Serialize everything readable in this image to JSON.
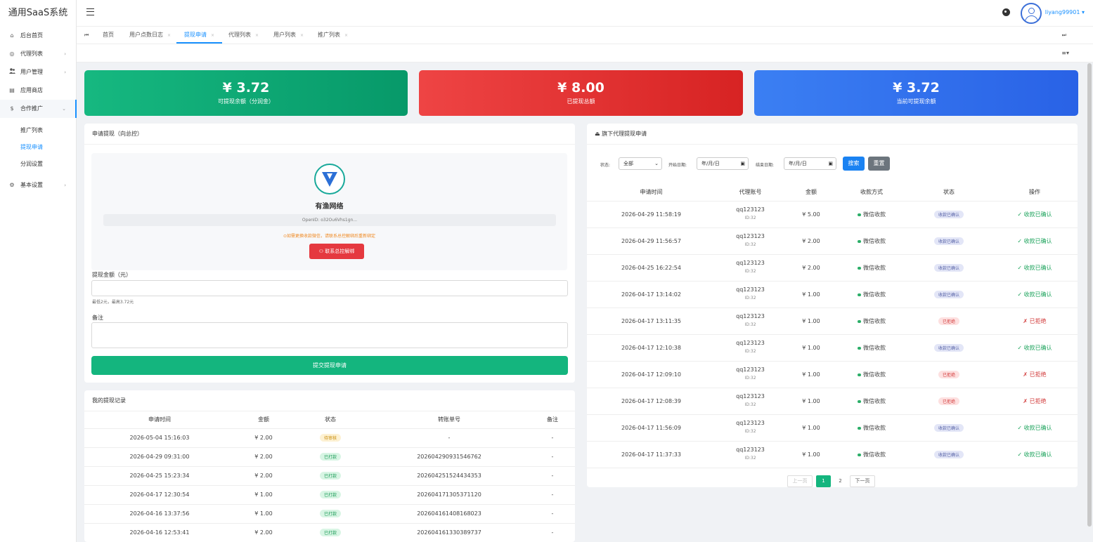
{
  "app": {
    "title": "通用SaaS系统"
  },
  "sidebar": {
    "items": [
      {
        "label": "后台首页",
        "icon": "home-icon",
        "glyph": "⌂",
        "arrow": ""
      },
      {
        "label": "代理列表",
        "icon": "globe-icon",
        "glyph": "◎",
        "arrow": "›"
      },
      {
        "label": "用户管理",
        "icon": "users-icon",
        "glyph": "👥",
        "arrow": "›"
      },
      {
        "label": "应用商店",
        "icon": "store-icon",
        "glyph": "▤",
        "arrow": ""
      },
      {
        "label": "合作推广",
        "icon": "dollar-icon",
        "glyph": "$",
        "arrow": "⌄"
      },
      {
        "label": "基本设置",
        "icon": "gear-icon",
        "glyph": "⚙",
        "arrow": "›"
      }
    ],
    "subitems": [
      {
        "label": "推广列表"
      },
      {
        "label": "提现申请"
      },
      {
        "label": "分润设置"
      }
    ]
  },
  "header": {
    "username": "liyang99901",
    "user_caret": "▾",
    "menu_caret": "≡▾"
  },
  "tabs": [
    {
      "label": "首页",
      "close": ""
    },
    {
      "label": "用户点数日志",
      "close": "×"
    },
    {
      "label": "提现申请",
      "close": "×"
    },
    {
      "label": "代理列表",
      "close": "×"
    },
    {
      "label": "用户列表",
      "close": "×"
    },
    {
      "label": "推广列表",
      "close": "×"
    }
  ],
  "stats": [
    {
      "value": "¥ 3.72",
      "label": "可提现余额（分润金）",
      "color": "#10ab73"
    },
    {
      "value": "¥ 8.00",
      "label": "已提现总额",
      "color": "#e33232"
    },
    {
      "value": "¥ 3.72",
      "label": "当前可提现余额",
      "color": "#3270ec"
    }
  ],
  "apply": {
    "title": "申请提现（向总控）",
    "user_name": "有渔网络",
    "openid": "OpenID: o32Ou6Vhs1gn...",
    "warning": "⊙如需更换收款微信，请联系总控解绑后重新绑定",
    "unbind_button": "联系总控解绑",
    "amount_label": "提现金额（元）",
    "amount_value": "",
    "amount_help": "最低2元，最高3.72元",
    "remark_label": "备注",
    "remark_value": "",
    "submit_button": "提交提现申请"
  },
  "records": {
    "title": "我的提现记录",
    "columns": [
      "申请时间",
      "金额",
      "状态",
      "转账单号",
      "备注"
    ],
    "rows": [
      {
        "time": "2026-05-04 15:16:03",
        "amount": "¥ 2.00",
        "status": "待审核",
        "status_type": "pending",
        "order": "-",
        "remark": "-"
      },
      {
        "time": "2026-04-29 09:31:00",
        "amount": "¥ 2.00",
        "status": "已打款",
        "status_type": "paid",
        "order": "202604290931546762",
        "remark": "-"
      },
      {
        "time": "2026-04-25 15:23:34",
        "amount": "¥ 2.00",
        "status": "已打款",
        "status_type": "paid",
        "order": "202604251524434353",
        "remark": "-"
      },
      {
        "time": "2026-04-17 12:30:54",
        "amount": "¥ 1.00",
        "status": "已打款",
        "status_type": "paid",
        "order": "202604171305371120",
        "remark": "-"
      },
      {
        "time": "2026-04-16 13:37:56",
        "amount": "¥ 1.00",
        "status": "已打款",
        "status_type": "paid",
        "order": "202604161408168023",
        "remark": "-"
      },
      {
        "time": "2026-04-16 12:53:41",
        "amount": "¥ 2.00",
        "status": "已打款",
        "status_type": "paid",
        "order": "202604161330389737",
        "remark": "-"
      }
    ]
  },
  "agents": {
    "title": "旗下代理提现申请",
    "filters": {
      "status_label": "状态:",
      "status_value": "全部",
      "start_label": "开始日期:",
      "start_value": "年/月/日",
      "end_label": "结束日期:",
      "end_value": "年/月/日",
      "search_button": "搜索",
      "reset_button": "重置"
    },
    "columns": [
      "申请时间",
      "代理账号",
      "金额",
      "收款方式",
      "状态",
      "操作"
    ],
    "rows": [
      {
        "time": "2026-04-29 11:58:19",
        "account": "qq123123",
        "id": "ID:32",
        "amount": "¥ 5.00",
        "method": "微信收款",
        "status": "收款已确认",
        "status_type": "confirmed",
        "op": "✓ 收款已确认"
      },
      {
        "time": "2026-04-29 11:56:57",
        "account": "qq123123",
        "id": "ID:32",
        "amount": "¥ 2.00",
        "method": "微信收款",
        "status": "收款已确认",
        "status_type": "confirmed",
        "op": "✓ 收款已确认"
      },
      {
        "time": "2026-04-25 16:22:54",
        "account": "qq123123",
        "id": "ID:32",
        "amount": "¥ 2.00",
        "method": "微信收款",
        "status": "收款已确认",
        "status_type": "confirmed",
        "op": "✓ 收款已确认"
      },
      {
        "time": "2026-04-17 13:14:02",
        "account": "qq123123",
        "id": "ID:32",
        "amount": "¥ 1.00",
        "method": "微信收款",
        "status": "收款已确认",
        "status_type": "confirmed",
        "op": "✓ 收款已确认"
      },
      {
        "time": "2026-04-17 13:11:35",
        "account": "qq123123",
        "id": "ID:32",
        "amount": "¥ 1.00",
        "method": "微信收款",
        "status": "已拒绝",
        "status_type": "rejected",
        "op": "✗ 已拒绝"
      },
      {
        "time": "2026-04-17 12:10:38",
        "account": "qq123123",
        "id": "ID:32",
        "amount": "¥ 1.00",
        "method": "微信收款",
        "status": "收款已确认",
        "status_type": "confirmed",
        "op": "✓ 收款已确认"
      },
      {
        "time": "2026-04-17 12:09:10",
        "account": "qq123123",
        "id": "ID:32",
        "amount": "¥ 1.00",
        "method": "微信收款",
        "status": "已拒绝",
        "status_type": "rejected",
        "op": "✗ 已拒绝"
      },
      {
        "time": "2026-04-17 12:08:39",
        "account": "qq123123",
        "id": "ID:32",
        "amount": "¥ 1.00",
        "method": "微信收款",
        "status": "已拒绝",
        "status_type": "rejected",
        "op": "✗ 已拒绝"
      },
      {
        "time": "2026-04-17 11:56:09",
        "account": "qq123123",
        "id": "ID:32",
        "amount": "¥ 1.00",
        "method": "微信收款",
        "status": "收款已确认",
        "status_type": "confirmed",
        "op": "✓ 收款已确认"
      },
      {
        "time": "2026-04-17 11:37:33",
        "account": "qq123123",
        "id": "ID:32",
        "amount": "¥ 1.00",
        "method": "微信收款",
        "status": "收款已确认",
        "status_type": "confirmed",
        "op": "✓ 收款已确认"
      }
    ],
    "pagination": {
      "prev": "上一页",
      "pages": [
        "1",
        "2"
      ],
      "current": "1",
      "next": "下一页"
    }
  }
}
